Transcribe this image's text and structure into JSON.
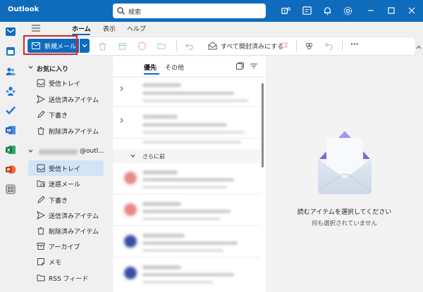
{
  "app": {
    "title": "Outlook"
  },
  "search": {
    "placeholder": "検索"
  },
  "titlebar_icons": [
    "teams-icon",
    "notes-icon",
    "bell-icon",
    "gear-icon"
  ],
  "window_controls": [
    "minimize-icon",
    "maximize-icon",
    "close-icon"
  ],
  "nav_rail": [
    "mail-icon",
    "calendar-icon",
    "people-icon",
    "groups-icon",
    "todo-icon",
    "word-icon",
    "excel-icon",
    "powerpoint-icon",
    "apps-icon"
  ],
  "menu": {
    "tabs": [
      {
        "label": "ホーム",
        "active": true
      },
      {
        "label": "表示",
        "active": false
      },
      {
        "label": "ヘルプ",
        "active": false
      }
    ]
  },
  "toolbar": {
    "new_mail_label": "新規メール",
    "mark_all_read_label": "すべて開封済みにする",
    "more_label": "···"
  },
  "folders": {
    "favorites_header": "お気に入り",
    "favorites": [
      {
        "label": "受信トレイ",
        "icon": "inbox-icon"
      },
      {
        "label": "送信済みアイテム",
        "icon": "send-icon"
      },
      {
        "label": "下書き",
        "icon": "pencil-icon"
      },
      {
        "label": "削除済みアイテム",
        "icon": "trash-icon"
      }
    ],
    "account_suffix": "@outl...",
    "account_folders": [
      {
        "label": "受信トレイ",
        "icon": "inbox-icon",
        "selected": true
      },
      {
        "label": "迷惑メール",
        "icon": "junk-icon"
      },
      {
        "label": "下書き",
        "icon": "pencil-icon"
      },
      {
        "label": "送信済みアイテム",
        "icon": "send-icon"
      },
      {
        "label": "削除済みアイテム",
        "icon": "trash-icon"
      },
      {
        "label": "アーカイブ",
        "icon": "archive-icon"
      },
      {
        "label": "メモ",
        "icon": "note-icon"
      },
      {
        "label": "RSS フィード",
        "icon": "folder-icon"
      }
    ]
  },
  "mail_list": {
    "tabs": [
      {
        "label": "優先",
        "active": true
      },
      {
        "label": "その他",
        "active": false
      }
    ],
    "group_label": "さらに前"
  },
  "reading_pane": {
    "empty_title": "読むアイテムを選択してください",
    "empty_subtitle": "何も選択されていません"
  },
  "colors": {
    "brand": "#0f6cbd",
    "highlight": "#e0202a",
    "selected": "#d1e4f8"
  }
}
